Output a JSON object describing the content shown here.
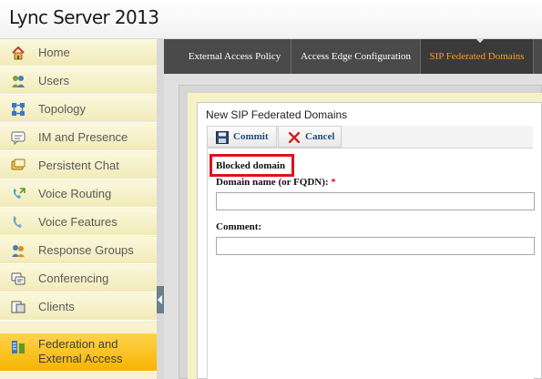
{
  "app": {
    "title": "Lync Server 2013"
  },
  "sidebar": {
    "items": [
      {
        "label": "Home",
        "icon": "home-icon"
      },
      {
        "label": "Users",
        "icon": "users-icon"
      },
      {
        "label": "Topology",
        "icon": "topology-icon"
      },
      {
        "label": "IM and Presence",
        "icon": "im-presence-icon"
      },
      {
        "label": "Persistent Chat",
        "icon": "persistent-chat-icon"
      },
      {
        "label": "Voice Routing",
        "icon": "voice-routing-icon"
      },
      {
        "label": "Voice Features",
        "icon": "voice-features-icon"
      },
      {
        "label": "Response Groups",
        "icon": "response-groups-icon"
      },
      {
        "label": "Conferencing",
        "icon": "conferencing-icon"
      },
      {
        "label": "Clients",
        "icon": "clients-icon"
      },
      {
        "label": "Federation and External Access",
        "icon": "federation-icon",
        "active": true
      }
    ]
  },
  "tabs": [
    {
      "label": "External Access Policy"
    },
    {
      "label": "Access Edge Configuration"
    },
    {
      "label": "SIP Federated Domains",
      "active": true
    }
  ],
  "form": {
    "title": "New SIP Federated Domains",
    "commit_label": "Commit",
    "cancel_label": "Cancel",
    "section_label": "Blocked domain",
    "domain_label": "Domain name (or FQDN):",
    "required_marker": "*",
    "domain_value": "",
    "comment_label": "Comment:",
    "comment_value": ""
  },
  "colors": {
    "accent_orange": "#ff9c1a",
    "active_nav": "#f6b400",
    "highlight_red": "#e0101b",
    "link_blue": "#1f4e79"
  }
}
